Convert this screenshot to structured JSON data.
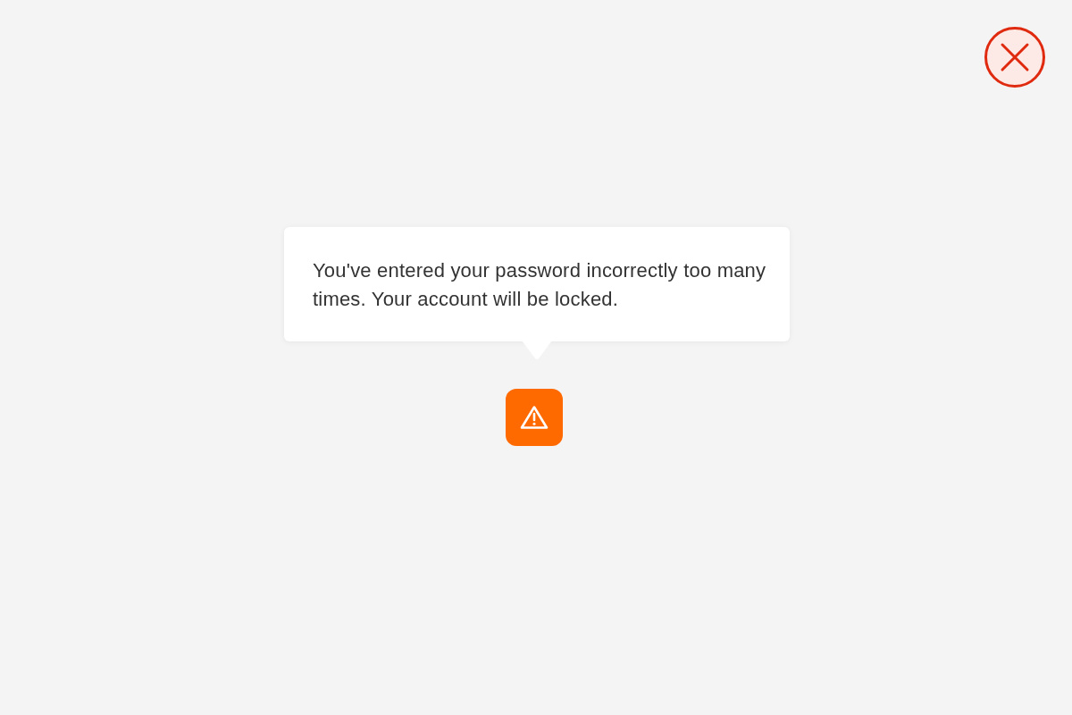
{
  "tooltip": {
    "message": "You've entered your password incorrectly too many times. Your account will be locked."
  }
}
